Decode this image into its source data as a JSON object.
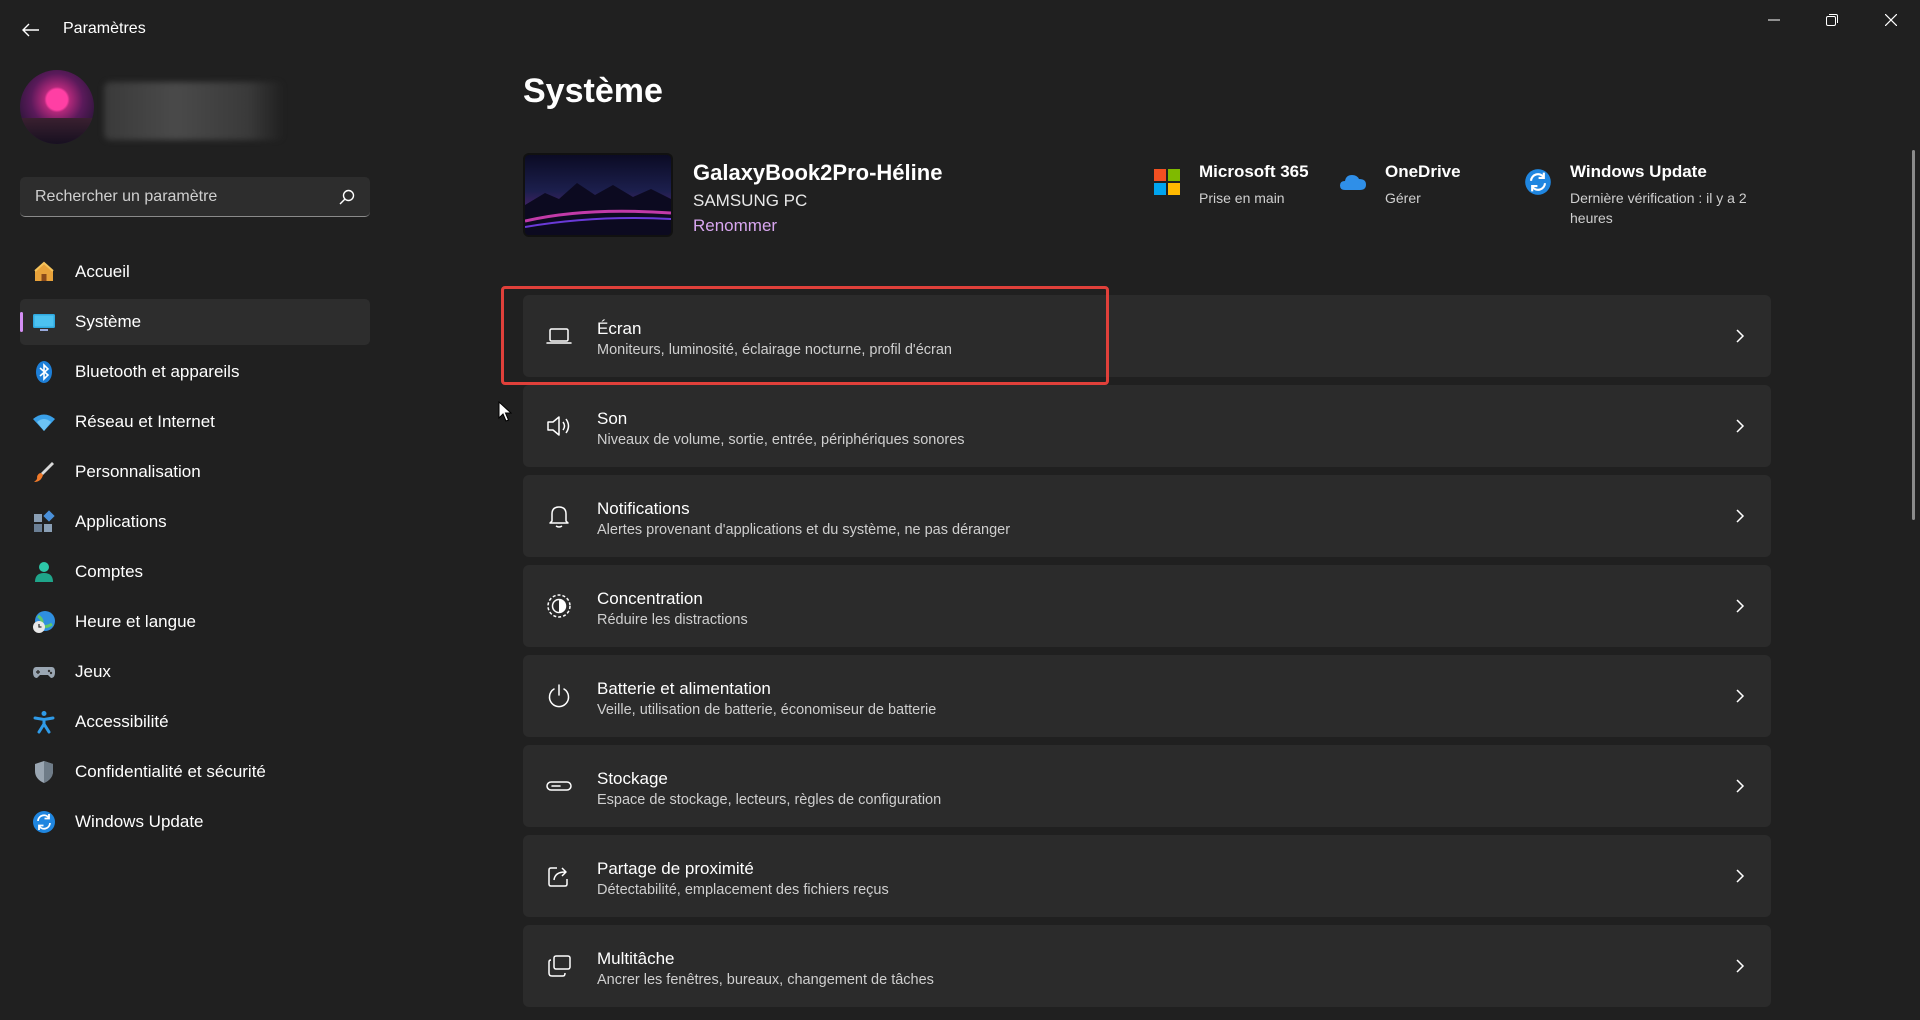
{
  "window": {
    "title": "Paramètres"
  },
  "sidebar": {
    "search_placeholder": "Rechercher un paramètre",
    "items": [
      {
        "label": "Accueil",
        "icon": "home-icon",
        "active": false
      },
      {
        "label": "Système",
        "icon": "monitor-icon",
        "active": true
      },
      {
        "label": "Bluetooth et appareils",
        "icon": "bluetooth-icon",
        "active": false
      },
      {
        "label": "Réseau et Internet",
        "icon": "wifi-icon",
        "active": false
      },
      {
        "label": "Personnalisation",
        "icon": "brush-icon",
        "active": false
      },
      {
        "label": "Applications",
        "icon": "apps-icon",
        "active": false
      },
      {
        "label": "Comptes",
        "icon": "person-icon",
        "active": false
      },
      {
        "label": "Heure et langue",
        "icon": "clock-globe-icon",
        "active": false
      },
      {
        "label": "Jeux",
        "icon": "gamepad-icon",
        "active": false
      },
      {
        "label": "Accessibilité",
        "icon": "accessibility-icon",
        "active": false
      },
      {
        "label": "Confidentialité et sécurité",
        "icon": "shield-icon",
        "active": false
      },
      {
        "label": "Windows Update",
        "icon": "windows-update-icon",
        "active": false
      }
    ]
  },
  "main": {
    "page_title": "Système",
    "device": {
      "name": "GalaxyBook2Pro-Héline",
      "model": "SAMSUNG PC",
      "rename_label": "Renommer"
    },
    "quick_links": [
      {
        "title": "Microsoft 365",
        "subtitle": "Prise en main",
        "icon": "microsoft-logo-icon"
      },
      {
        "title": "OneDrive",
        "subtitle": "Gérer",
        "icon": "onedrive-cloud-icon"
      },
      {
        "title": "Windows Update",
        "subtitle": "Dernière vérification : il y a 2 heures",
        "icon": "windows-update-icon"
      }
    ],
    "settings": [
      {
        "title": "Écran",
        "description": "Moniteurs, luminosité, éclairage nocturne, profil d'écran",
        "icon": "laptop-icon"
      },
      {
        "title": "Son",
        "description": "Niveaux de volume, sortie, entrée, périphériques sonores",
        "icon": "speaker-icon"
      },
      {
        "title": "Notifications",
        "description": "Alertes provenant d'applications et du système, ne pas déranger",
        "icon": "bell-icon"
      },
      {
        "title": "Concentration",
        "description": "Réduire les distractions",
        "icon": "focus-icon"
      },
      {
        "title": "Batterie et alimentation",
        "description": "Veille, utilisation de batterie, économiseur de batterie",
        "icon": "power-icon"
      },
      {
        "title": "Stockage",
        "description": "Espace de stockage, lecteurs, règles de configuration",
        "icon": "storage-drive-icon"
      },
      {
        "title": "Partage de proximité",
        "description": "Détectabilité, emplacement des fichiers reçus",
        "icon": "share-icon"
      },
      {
        "title": "Multitâche",
        "description": "Ancrer les fenêtres, bureaux, changement de tâches",
        "icon": "multitask-icon"
      }
    ]
  },
  "colors": {
    "background": "#202020",
    "card": "#2b2b2b",
    "accent": "#d48ef4",
    "highlight": "#e0403a"
  }
}
